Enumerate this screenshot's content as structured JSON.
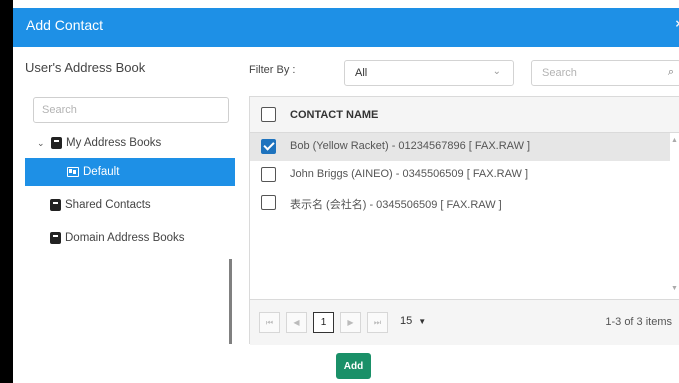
{
  "dialog": {
    "title": "Add Contact",
    "close_glyph": "×"
  },
  "address_book": {
    "heading": "User's Address Book",
    "search_placeholder": "Search",
    "tree": {
      "my_books": {
        "label": "My Address Books",
        "expanded": true
      },
      "default": {
        "label": "Default",
        "selected": true
      },
      "shared": {
        "label": "Shared Contacts"
      },
      "domain": {
        "label": "Domain Address Books"
      }
    }
  },
  "filter": {
    "label": "Filter By :",
    "selected": "All",
    "search_placeholder": "Search"
  },
  "grid": {
    "column_header": "CONTACT NAME",
    "rows": [
      {
        "name": "Bob (Yellow Racket) - 01234567896 [ FAX.RAW ]",
        "checked": true
      },
      {
        "name": "John Briggs (AINEO) - 0345506509 [ FAX.RAW ]",
        "checked": false
      },
      {
        "name": "表示名 (会社名) - 0345506509 [ FAX.RAW ]",
        "checked": false
      }
    ]
  },
  "pager": {
    "current_page": "1",
    "page_size": "15",
    "items_info": "1-3 of 3 items"
  },
  "actions": {
    "add_label": "Add"
  },
  "colors": {
    "primary": "#1e90e6",
    "add_button": "#1a9068",
    "checkbox": "#1e73be"
  }
}
